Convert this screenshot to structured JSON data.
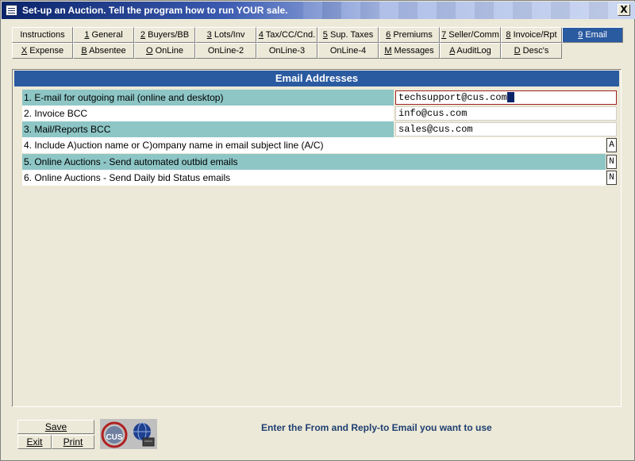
{
  "window": {
    "title": "Set-up an Auction.  Tell the program how to run YOUR sale.",
    "close_label": "X"
  },
  "tabs_row1": [
    {
      "key": "",
      "label": "Instructions",
      "active": false
    },
    {
      "key": "1",
      "label": " General",
      "active": false
    },
    {
      "key": "2",
      "label": " Buyers/BB",
      "active": false
    },
    {
      "key": "3",
      "label": " Lots/Inv",
      "active": false
    },
    {
      "key": "4",
      "label": " Tax/CC/Cnd.",
      "active": false
    },
    {
      "key": "5",
      "label": " Sup. Taxes",
      "active": false
    },
    {
      "key": "6",
      "label": " Premiums",
      "active": false
    },
    {
      "key": "7",
      "label": " Seller/Comm",
      "active": false
    },
    {
      "key": "8",
      "label": " Invoice/Rpt",
      "active": false
    },
    {
      "key": "9",
      "label": " Email",
      "active": true
    }
  ],
  "tabs_row2": [
    {
      "key": "X",
      "label": " Expense"
    },
    {
      "key": "B",
      "label": " Absentee"
    },
    {
      "key": "O",
      "label": " OnLine"
    },
    {
      "key": "",
      "label": "OnLine-2"
    },
    {
      "key": "",
      "label": "OnLine-3"
    },
    {
      "key": "",
      "label": "OnLine-4"
    },
    {
      "key": "M",
      "label": " Messages"
    },
    {
      "key": "A",
      "label": " AuditLog"
    },
    {
      "key": "D",
      "label": " Desc's"
    }
  ],
  "panel": {
    "header": "Email Addresses",
    "rows": [
      {
        "label": "1. E-mail for outgoing mail (online and desktop)",
        "value": "techsupport@cus.com"
      },
      {
        "label": "2. Invoice BCC",
        "value": "info@cus.com"
      },
      {
        "label": "3. Mail/Reports BCC",
        "value": "sales@cus.com"
      },
      {
        "label": "4. Include A)uction name or C)ompany name in email subject line (A/C)",
        "value": "A"
      },
      {
        "label": "5. Online Auctions - Send automated outbid emails",
        "value": "N"
      },
      {
        "label": "6. Online Auctions - Send Daily bid Status emails",
        "value": "N"
      }
    ]
  },
  "buttons": {
    "save": "Save",
    "exit": "Exit",
    "print": "Print"
  },
  "logo_text": "CUS",
  "status_message": "Enter the From and Reply-to Email you want to use",
  "colors": {
    "active_tab": "#2a5aa0",
    "header": "#2a5aa0",
    "teal_row": "#8ec6c6",
    "background": "#ece9d8"
  }
}
